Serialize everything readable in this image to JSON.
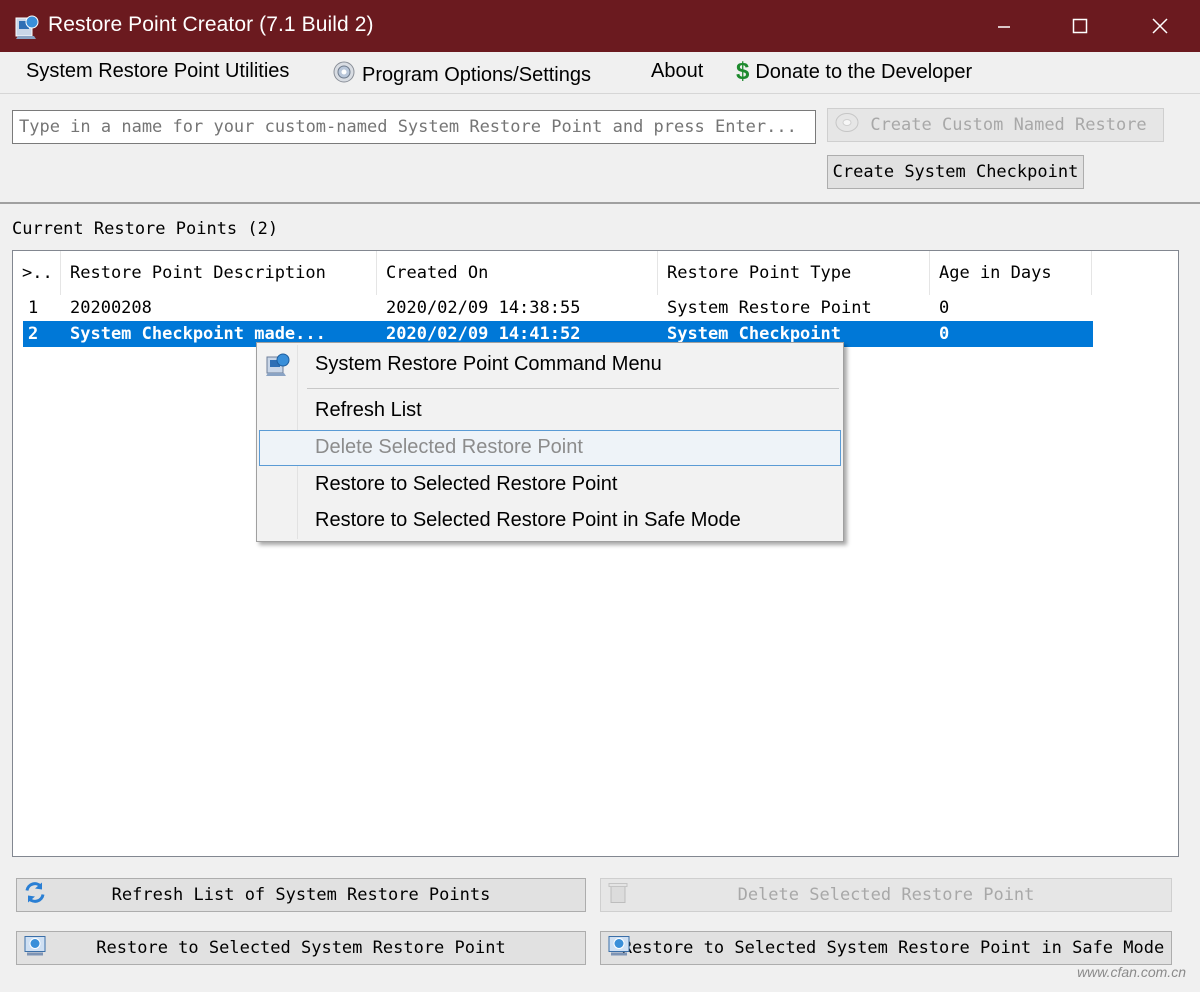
{
  "window": {
    "title": "Restore Point Creator (7.1 Build 2)",
    "controls": [
      "minimize-icon",
      "maximize-icon",
      "close-icon"
    ],
    "title_bar_color": "#6b1a1f"
  },
  "menu": {
    "items": [
      {
        "label": "System Restore Point Utilities",
        "icon": ""
      },
      {
        "label": "Program Options/Settings",
        "icon": "gear-disc-icon"
      },
      {
        "label": "About",
        "icon": ""
      },
      {
        "label": "Donate to the Developer",
        "icon": "dollar-icon"
      }
    ]
  },
  "custom_restore": {
    "placeholder": "Type in a name for your custom-named System Restore Point and press Enter...",
    "create_named_label": "Create Custom Named Restore",
    "create_checkpoint_label": "Create System Checkpoint"
  },
  "restore_points": {
    "label": "Current Restore Points (2)",
    "columns": [
      ">..",
      "Restore Point Description",
      "Created On",
      "Restore Point Type",
      "Age in Days"
    ],
    "rows": [
      {
        "id": "1",
        "description": "20200208",
        "created_on": "2020/02/09 14:38:55",
        "type": "System Restore Point",
        "age": "0",
        "selected": false
      },
      {
        "id": "2",
        "description": "System Checkpoint made...",
        "created_on": "2020/02/09 14:41:52",
        "type": "System Checkpoint",
        "age": "0",
        "selected": true
      }
    ],
    "selection_color": "#0078d7"
  },
  "context_menu": {
    "title": "System Restore Point Command Menu",
    "items": [
      {
        "label": "Refresh List",
        "enabled": true
      },
      {
        "label": "Delete Selected Restore Point",
        "enabled": false,
        "hovered": true
      },
      {
        "label": "Restore to Selected Restore Point",
        "enabled": true
      },
      {
        "label": "Restore to Selected Restore Point in Safe Mode",
        "enabled": true
      }
    ]
  },
  "bottom_buttons": {
    "refresh_label": "Refresh List of System Restore Points",
    "delete_label": "Delete Selected Restore Point",
    "restore_label": "Restore to Selected System Restore Point",
    "restore_safe_label": "Restore to Selected System Restore Point in Safe Mode"
  },
  "watermark": "www.cfan.com.cn"
}
